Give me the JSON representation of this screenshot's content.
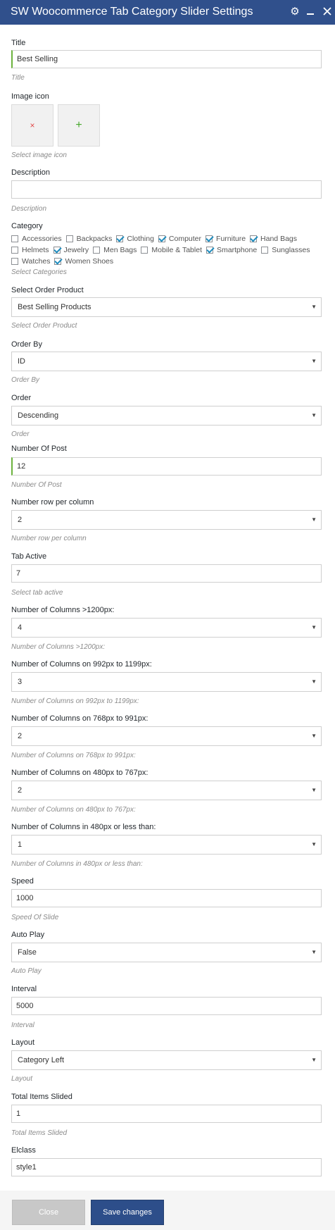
{
  "header": {
    "title": "SW Woocommerce Tab Category Slider Settings"
  },
  "title_field": {
    "label": "Title",
    "value": "Best Selling",
    "help": "Title"
  },
  "image_icon": {
    "label": "Image icon",
    "remove_glyph": "×",
    "add_glyph": "+",
    "help": "Select image icon"
  },
  "description": {
    "label": "Description",
    "value": "",
    "help": "Description"
  },
  "category": {
    "label": "Category",
    "items": [
      {
        "label": "Accessories",
        "checked": false
      },
      {
        "label": "Backpacks",
        "checked": false
      },
      {
        "label": "Clothing",
        "checked": true
      },
      {
        "label": "Computer",
        "checked": true
      },
      {
        "label": "Furniture",
        "checked": true
      },
      {
        "label": "Hand Bags",
        "checked": true
      },
      {
        "label": "Helmets",
        "checked": false
      },
      {
        "label": "Jewelry",
        "checked": true
      },
      {
        "label": "Men Bags",
        "checked": false
      },
      {
        "label": "Mobile & Tablet",
        "checked": false
      },
      {
        "label": "Smartphone",
        "checked": true
      },
      {
        "label": "Sunglasses",
        "checked": false
      },
      {
        "label": "Watches",
        "checked": false
      },
      {
        "label": "Women Shoes",
        "checked": true
      }
    ],
    "help": "Select Categories"
  },
  "order_product": {
    "label": "Select Order Product",
    "value": "Best Selling Products",
    "help": "Select Order Product"
  },
  "order_by": {
    "label": "Order By",
    "value": "ID",
    "help": "Order By"
  },
  "order": {
    "label": "Order",
    "value": "Descending",
    "help": "Order"
  },
  "number_of_post": {
    "label": "Number Of Post",
    "value": "12",
    "help": "Number Of Post"
  },
  "rows_per_column": {
    "label": "Number row per column",
    "value": "2",
    "help": "Number row per column"
  },
  "tab_active": {
    "label": "Tab Active",
    "value": "7",
    "help": "Select tab active"
  },
  "cols_1200": {
    "label": "Number of Columns >1200px:",
    "value": "4",
    "help": "Number of Columns >1200px:"
  },
  "cols_992": {
    "label": "Number of Columns on 992px to 1199px:",
    "value": "3",
    "help": "Number of Columns on 992px to 1199px:"
  },
  "cols_768": {
    "label": "Number of Columns on 768px to 991px:",
    "value": "2",
    "help": "Number of Columns on 768px to 991px:"
  },
  "cols_480": {
    "label": "Number of Columns on 480px to 767px:",
    "value": "2",
    "help": "Number of Columns on 480px to 767px:"
  },
  "cols_less_480": {
    "label": "Number of Columns in 480px or less than:",
    "value": "1",
    "help": "Number of Columns in 480px or less than:"
  },
  "speed": {
    "label": "Speed",
    "value": "1000",
    "help": "Speed Of Slide"
  },
  "auto_play": {
    "label": "Auto Play",
    "value": "False",
    "help": "Auto Play"
  },
  "interval": {
    "label": "Interval",
    "value": "5000",
    "help": "Interval"
  },
  "layout": {
    "label": "Layout",
    "value": "Category Left",
    "help": "Layout"
  },
  "total_items_slided": {
    "label": "Total Items Slided",
    "value": "1",
    "help": "Total Items Slided"
  },
  "elclass": {
    "label": "Elclass",
    "value": "style1"
  },
  "footer": {
    "close_label": "Close",
    "save_label": "Save changes"
  },
  "colors": {
    "header_bg": "#30508c",
    "save_bg": "#2d4e8a",
    "close_bg": "#c8c8c8",
    "accent_green": "#6cb23d"
  }
}
